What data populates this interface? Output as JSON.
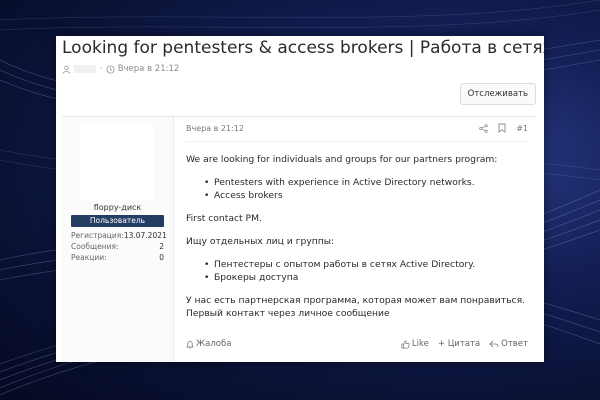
{
  "thread": {
    "title": "Looking for pentesters & access brokers | Работа в сетях",
    "posted_time": "Вчера в 21:12",
    "meta_separator": "·",
    "follow_label": "Отслеживать"
  },
  "author": {
    "username": "floppy-диск",
    "role": "Пользователь",
    "stats": [
      {
        "label": "Регистрация:",
        "value": "13.07.2021"
      },
      {
        "label": "Сообщения:",
        "value": "2"
      },
      {
        "label": "Реакции:",
        "value": "0"
      }
    ]
  },
  "post": {
    "date": "Вчера в 21:12",
    "number": "#1",
    "intro_en": "We are looking for individuals and groups for our partners program:",
    "bullets_en": [
      "Pentesters with experience in Active Directory networks.",
      "Access brokers"
    ],
    "contact_en": "First contact PM.",
    "intro_ru": "Ищу отдельных лиц и группы:",
    "bullets_ru": [
      "Пентестеры с опытом работы в сетях Active Directory.",
      "Брокеры доступа"
    ],
    "closing_ru_1": "У нас есть партнерская программа, которая может вам понравиться.",
    "closing_ru_2": "Первый контакт через личное сообщение"
  },
  "actions": {
    "report": "Жалоба",
    "like": "Like",
    "quote": "+ Цитата",
    "reply": "Ответ"
  },
  "icons": [
    "user-icon",
    "clock-icon",
    "share-icon",
    "bookmark-icon",
    "bell-icon",
    "like-icon",
    "reply-icon"
  ],
  "colors": {
    "badge_bg": "#243d63",
    "background": "#0a1236"
  }
}
